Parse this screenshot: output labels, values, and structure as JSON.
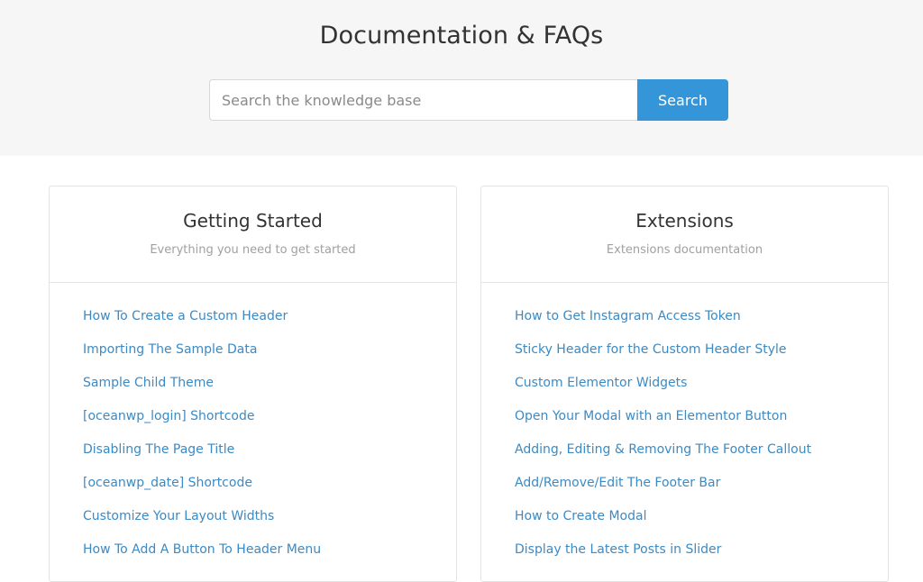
{
  "header": {
    "title": "Documentation & FAQs",
    "search_placeholder": "Search the knowledge base",
    "search_button": "Search"
  },
  "sections": [
    {
      "title": "Getting Started",
      "subtitle": "Everything you need to get started",
      "links": [
        "How To Create a Custom Header",
        "Importing The Sample Data",
        "Sample Child Theme",
        "[oceanwp_login] Shortcode",
        "Disabling The Page Title",
        "[oceanwp_date] Shortcode",
        "Customize Your Layout Widths",
        "How To Add A Button To Header Menu"
      ]
    },
    {
      "title": "Extensions",
      "subtitle": "Extensions documentation",
      "links": [
        "How to Get Instagram Access Token",
        "Sticky Header for the Custom Header Style",
        "Custom Elementor Widgets",
        "Open Your Modal with an Elementor Button",
        "Adding, Editing & Removing The Footer Callout",
        "Add/Remove/Edit The Footer Bar",
        "How to Create Modal",
        "Display the Latest Posts in Slider"
      ]
    }
  ],
  "colors": {
    "accent": "#3496d8",
    "link": "#3b8ac4",
    "hero_bg": "#f6f6f6"
  }
}
